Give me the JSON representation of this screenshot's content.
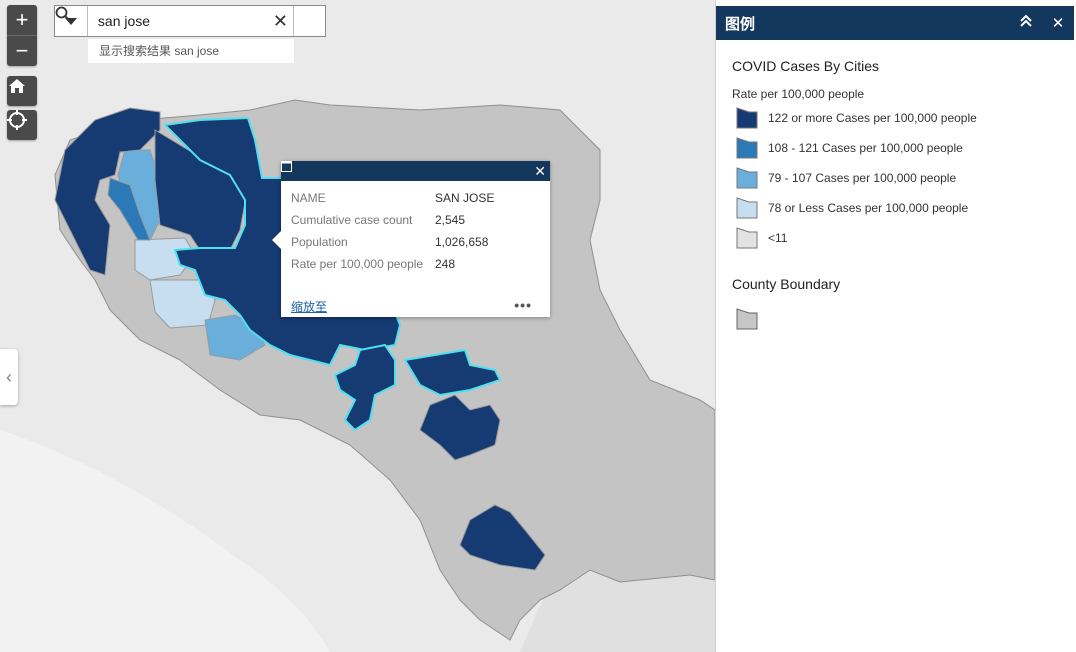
{
  "search": {
    "value": "san jose",
    "suggestion": "显示搜索结果 san jose"
  },
  "controls": {
    "zoom_in": "+",
    "zoom_out": "−",
    "side_toggle": "‹"
  },
  "popup": {
    "fields": [
      {
        "key": "NAME",
        "value": "SAN JOSE"
      },
      {
        "key": "Cumulative case count",
        "value": "2,545"
      },
      {
        "key": "Population",
        "value": "1,026,658"
      },
      {
        "key": "Rate per 100,000 people",
        "value": "248"
      }
    ],
    "zoom_link": "缩放至",
    "more": "•••"
  },
  "legend": {
    "title": "图例",
    "collapse_icon": "⌃⌃",
    "close_icon": "✕",
    "layers": [
      {
        "name": "COVID Cases By Cities",
        "subtitle": "Rate per 100,000 people",
        "items": [
          {
            "label": "122 or more Cases per 100,000 people",
            "color": "#163a72"
          },
          {
            "label": "108 - 121 Cases per 100,000 people",
            "color": "#2c79b8"
          },
          {
            "label": "79 - 107 Cases per 100,000 people",
            "color": "#6aaedc"
          },
          {
            "label": "78 or Less Cases per 100,000 people",
            "color": "#c7ddf0"
          },
          {
            "label": "<11",
            "color": "#e2e2e2"
          }
        ]
      },
      {
        "name": "County Boundary",
        "items": [
          {
            "label": "",
            "color": "#c6c6c6"
          }
        ]
      }
    ]
  },
  "colors": {
    "header": "#14375e",
    "county": "#c4c4c4",
    "highlight": "#4fe0f0",
    "water": "#f0f0f0"
  }
}
